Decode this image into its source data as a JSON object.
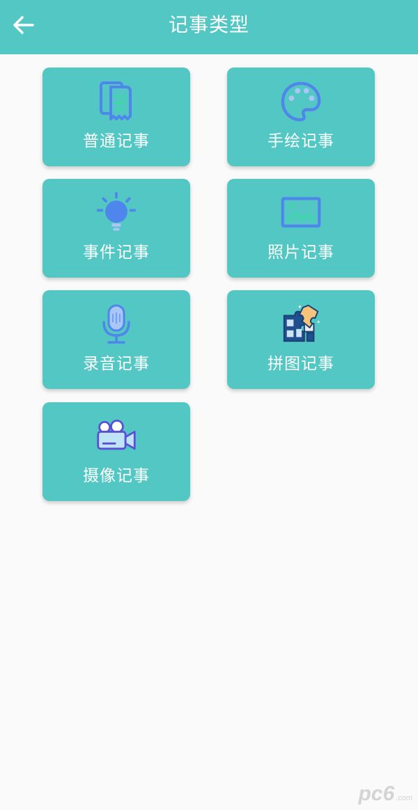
{
  "header": {
    "title": "记事类型",
    "back_icon": "arrow-left-icon",
    "background": "#52c7c3"
  },
  "cards": [
    {
      "label": "普通记事",
      "icon": "document-icon"
    },
    {
      "label": "手绘记事",
      "icon": "palette-icon"
    },
    {
      "label": "事件记事",
      "icon": "lightbulb-icon"
    },
    {
      "label": "照片记事",
      "icon": "image-icon"
    },
    {
      "label": "录音记事",
      "icon": "microphone-icon"
    },
    {
      "label": "拼图记事",
      "icon": "puzzle-icon"
    },
    {
      "label": "摄像记事",
      "icon": "video-camera-icon"
    }
  ],
  "watermark": {
    "text": "pc6",
    "subtext": ".com"
  },
  "colors": {
    "accent": "#52c7c3",
    "icon_blue": "#4f86ec",
    "background": "#fafafa"
  }
}
